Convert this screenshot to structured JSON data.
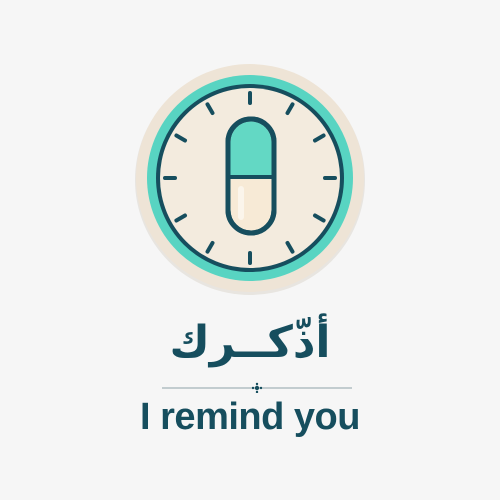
{
  "brand": {
    "arabic_name": "أذّكــرك",
    "tagline": "I remind you",
    "logo_icon": "pill-clock-icon"
  },
  "colors": {
    "background": "#f6f6f6",
    "outer_ring": "#eee4d6",
    "teal_ring": "#58d4c2",
    "dark_teal": "#164e5e",
    "clock_face": "#f3ebde",
    "pill_teal": "#63d8c4",
    "pill_cream": "#f7ead6"
  }
}
